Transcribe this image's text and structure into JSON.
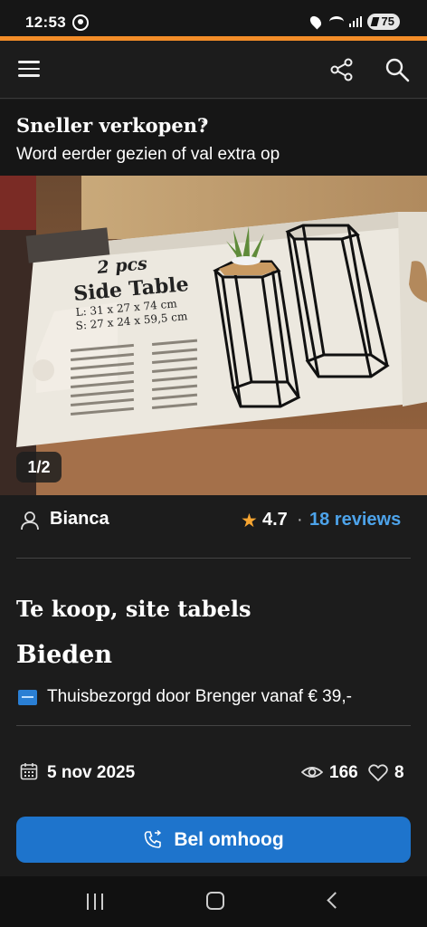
{
  "status_bar": {
    "time": "12:53",
    "battery": "75",
    "icons": [
      "whatsapp-icon",
      "location-icon",
      "wifi-icon",
      "signal-icon",
      "battery-icon"
    ]
  },
  "app_bar": {
    "icons": [
      "menu-icon",
      "share-icon",
      "search-icon"
    ]
  },
  "promo": {
    "title": "Sneller verkopen?",
    "chevron": "›",
    "subtitle": "Word eerder gezien of val extra op"
  },
  "photo": {
    "counter": "1/2",
    "box_text": {
      "count": "2 pcs",
      "product": "Side Table",
      "size_l": "L: 31 x 27 x 74 cm",
      "size_s": "S: 27 x 24 x 59,5 cm"
    }
  },
  "seller": {
    "name": "Bianca",
    "rating": "4.7",
    "separator": "·",
    "reviews": "18 reviews"
  },
  "listing": {
    "title": "Te koop, site tabels",
    "price": "Bieden",
    "delivery": "Thuisbezorgd door Brenger vanaf € 39,-",
    "date": "5 nov 2025",
    "views": "166",
    "favorites": "8"
  },
  "cta": {
    "label": "Bel omhoog"
  },
  "colors": {
    "accent_orange": "#f28c28",
    "link_blue": "#4da3ea",
    "button_blue": "#1e74cc",
    "star_gold": "#f6a531",
    "background": "#1c1c1c"
  }
}
